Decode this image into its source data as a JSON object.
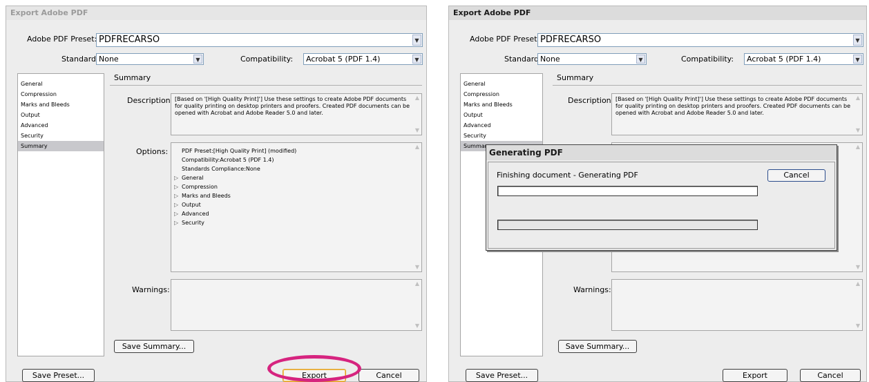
{
  "dialog1": {
    "title": "Export Adobe PDF",
    "preset_label": "Adobe PDF Preset:",
    "preset_value": "PDFRECARSO",
    "standard_label": "Standard:",
    "standard_value": "None",
    "compat_label": "Compatibility:",
    "compat_value": "Acrobat 5 (PDF 1.4)",
    "nav": [
      "General",
      "Compression",
      "Marks and Bleeds",
      "Output",
      "Advanced",
      "Security",
      "Summary"
    ],
    "selected_nav": "Summary",
    "section_title": "Summary",
    "description_label": "Description:",
    "description_text": "[Based on '[High Quality Print]'] Use these settings to create Adobe PDF documents for quality printing on desktop printers and proofers. Created PDF documents can be opened with Acrobat and Adobe Reader 5.0 and later.",
    "options_label": "Options:",
    "options_lines": [
      "PDF Preset:[High Quality Print] (modified)",
      "Compatibility:Acrobat 5 (PDF 1.4)",
      "Standards Compliance:None"
    ],
    "options_groups": [
      "General",
      "Compression",
      "Marks and Bleeds",
      "Output",
      "Advanced",
      "Security"
    ],
    "warnings_label": "Warnings:",
    "save_summary_label": "Save Summary...",
    "save_preset_label": "Save Preset...",
    "export_label": "Export",
    "cancel_label": "Cancel"
  },
  "dialog2": {
    "title": "Export Adobe PDF",
    "preset_label": "Adobe PDF Preset:",
    "preset_value": "PDFRECARSO",
    "standard_label": "Standard:",
    "standard_value": "None",
    "compat_label": "Compatibility:",
    "compat_value": "Acrobat 5 (PDF 1.4)",
    "nav": [
      "General",
      "Compression",
      "Marks and Bleeds",
      "Output",
      "Advanced",
      "Security",
      "Summar"
    ],
    "section_title": "Summary",
    "description_label": "Description:",
    "description_text": "[Based on '[High Quality Print]'] Use these settings to create Adobe PDF documents for quality printing on desktop printers and proofers. Created PDF documents can be opened with Acrobat and Adobe Reader 5.0 and later.",
    "warnings_label": "Warnings:",
    "save_summary_label": "Save Summary...",
    "save_preset_label": "Save Preset...",
    "export_label": "Export",
    "cancel_label": "Cancel"
  },
  "modal": {
    "title": "Generating PDF",
    "status_text": "Finishing document - Generating PDF",
    "cancel_label": "Cancel",
    "progress1": 0.0,
    "progress2": 0.0
  },
  "colors": {
    "highlight_ring": "#d6247f",
    "default_button_border": "#e0a020",
    "field_border": "#7f9db9"
  },
  "icons": {
    "dropdown": "chevron-down-icon",
    "expand": "triangle-right-icon",
    "scroll_up": "scroll-up-icon",
    "scroll_down": "scroll-down-icon"
  }
}
